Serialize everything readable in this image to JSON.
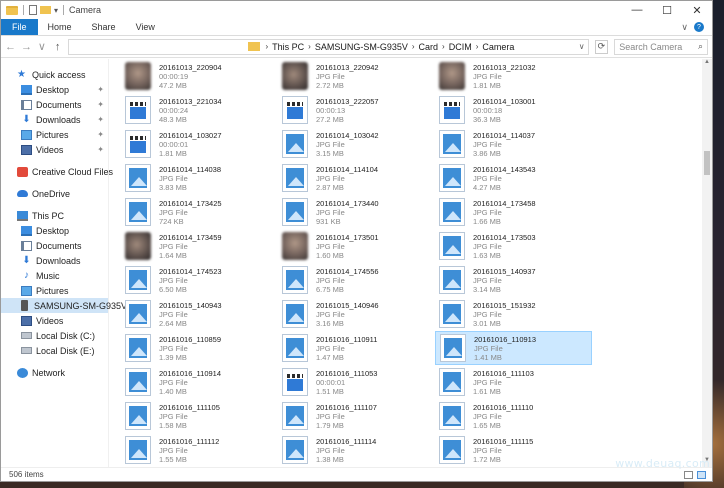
{
  "window": {
    "title": "Camera"
  },
  "title_controls": {
    "minimize": "—",
    "maximize": "☐",
    "close": "✕"
  },
  "ribbon": {
    "tabs": [
      "File",
      "Home",
      "Share",
      "View"
    ],
    "expand": "∨",
    "help": "?"
  },
  "nav_buttons": {
    "back": "←",
    "forward": "→",
    "recent": "∨",
    "up": "↑"
  },
  "address": {
    "crumbs": [
      "This PC",
      "SAMSUNG-SM-G935V",
      "Card",
      "DCIM",
      "Camera"
    ],
    "dropdown": "∨",
    "refresh": "⟳"
  },
  "search": {
    "placeholder": "Search Camera",
    "icon": "⌕"
  },
  "sidebar": {
    "items": [
      {
        "label": "Quick access",
        "icon": "star-icon"
      },
      {
        "label": "Desktop",
        "icon": "desktop-icon",
        "pinned": true
      },
      {
        "label": "Documents",
        "icon": "documents-icon",
        "pinned": true
      },
      {
        "label": "Downloads",
        "icon": "downloads-icon",
        "pinned": true
      },
      {
        "label": "Pictures",
        "icon": "pictures-icon",
        "pinned": true
      },
      {
        "label": "Videos",
        "icon": "videos-icon",
        "pinned": true
      },
      {
        "label": "Creative Cloud Files",
        "icon": "creative-cloud-icon"
      },
      {
        "label": "OneDrive",
        "icon": "onedrive-icon"
      },
      {
        "label": "This PC",
        "icon": "this-pc-icon"
      },
      {
        "label": "Desktop",
        "icon": "desktop-icon"
      },
      {
        "label": "Documents",
        "icon": "documents-icon"
      },
      {
        "label": "Downloads",
        "icon": "downloads-icon"
      },
      {
        "label": "Music",
        "icon": "music-icon"
      },
      {
        "label": "Pictures",
        "icon": "pictures-icon"
      },
      {
        "label": "SAMSUNG-SM-G935V",
        "icon": "phone-icon",
        "selected": true
      },
      {
        "label": "Videos",
        "icon": "videos-icon"
      },
      {
        "label": "Local Disk (C:)",
        "icon": "disk-icon"
      },
      {
        "label": "Local Disk (E:)",
        "icon": "disk-icon"
      },
      {
        "label": "Network",
        "icon": "network-icon"
      }
    ]
  },
  "files": [
    {
      "name": "20161013_220904",
      "type": "00:00:19",
      "size": "47.2 MB",
      "thumb": "blur"
    },
    {
      "name": "20161013_220942",
      "type": "JPG File",
      "size": "2.72 MB",
      "thumb": "blur"
    },
    {
      "name": "20161013_221032",
      "type": "JPG File",
      "size": "1.81 MB",
      "thumb": "blur"
    },
    {
      "name": "20161013_221034",
      "type": "00:00:24",
      "size": "48.3 MB",
      "thumb": "video"
    },
    {
      "name": "20161013_222057",
      "type": "00:00:13",
      "size": "27.2 MB",
      "thumb": "video"
    },
    {
      "name": "20161014_103001",
      "type": "00:00:18",
      "size": "36.3 MB",
      "thumb": "video"
    },
    {
      "name": "20161014_103027",
      "type": "00:00:01",
      "size": "1.81 MB",
      "thumb": "video"
    },
    {
      "name": "20161014_103042",
      "type": "JPG File",
      "size": "3.15 MB",
      "thumb": "photo"
    },
    {
      "name": "20161014_114037",
      "type": "JPG File",
      "size": "3.86 MB",
      "thumb": "photo"
    },
    {
      "name": "20161014_114038",
      "type": "JPG File",
      "size": "3.83 MB",
      "thumb": "photo"
    },
    {
      "name": "20161014_114104",
      "type": "JPG File",
      "size": "2.87 MB",
      "thumb": "photo"
    },
    {
      "name": "20161014_143543",
      "type": "JPG File",
      "size": "4.27 MB",
      "thumb": "photo"
    },
    {
      "name": "20161014_173425",
      "type": "JPG File",
      "size": "724 KB",
      "thumb": "photo"
    },
    {
      "name": "20161014_173440",
      "type": "JPG File",
      "size": "931 KB",
      "thumb": "photo"
    },
    {
      "name": "20161014_173458",
      "type": "JPG File",
      "size": "1.66 MB",
      "thumb": "photo"
    },
    {
      "name": "20161014_173459",
      "type": "JPG File",
      "size": "1.64 MB",
      "thumb": "blur"
    },
    {
      "name": "20161014_173501",
      "type": "JPG File",
      "size": "1.60 MB",
      "thumb": "blur"
    },
    {
      "name": "20161014_173503",
      "type": "JPG File",
      "size": "1.63 MB",
      "thumb": "photo"
    },
    {
      "name": "20161014_174523",
      "type": "JPG File",
      "size": "6.50 MB",
      "thumb": "photo"
    },
    {
      "name": "20161014_174556",
      "type": "JPG File",
      "size": "6.75 MB",
      "thumb": "photo"
    },
    {
      "name": "20161015_140937",
      "type": "JPG File",
      "size": "3.14 MB",
      "thumb": "photo"
    },
    {
      "name": "20161015_140943",
      "type": "JPG File",
      "size": "2.64 MB",
      "thumb": "photo"
    },
    {
      "name": "20161015_140946",
      "type": "JPG File",
      "size": "3.16 MB",
      "thumb": "photo"
    },
    {
      "name": "20161015_151932",
      "type": "JPG File",
      "size": "3.01 MB",
      "thumb": "photo"
    },
    {
      "name": "20161016_110859",
      "type": "JPG File",
      "size": "1.39 MB",
      "thumb": "photo"
    },
    {
      "name": "20161016_110911",
      "type": "JPG File",
      "size": "1.47 MB",
      "thumb": "photo"
    },
    {
      "name": "20161016_110913",
      "type": "JPG File",
      "size": "1.41 MB",
      "thumb": "photo",
      "selected": true
    },
    {
      "name": "20161016_110914",
      "type": "JPG File",
      "size": "1.40 MB",
      "thumb": "photo"
    },
    {
      "name": "20161016_111053",
      "type": "00:00:01",
      "size": "1.51 MB",
      "thumb": "video"
    },
    {
      "name": "20161016_111103",
      "type": "JPG File",
      "size": "1.61 MB",
      "thumb": "photo"
    },
    {
      "name": "20161016_111105",
      "type": "JPG File",
      "size": "1.58 MB",
      "thumb": "photo"
    },
    {
      "name": "20161016_111107",
      "type": "JPG File",
      "size": "1.79 MB",
      "thumb": "photo"
    },
    {
      "name": "20161016_111110",
      "type": "JPG File",
      "size": "1.65 MB",
      "thumb": "photo"
    },
    {
      "name": "20161016_111112",
      "type": "JPG File",
      "size": "1.55 MB",
      "thumb": "photo"
    },
    {
      "name": "20161016_111114",
      "type": "JPG File",
      "size": "1.38 MB",
      "thumb": "photo"
    },
    {
      "name": "20161016_111115",
      "type": "JPG File",
      "size": "1.72 MB",
      "thumb": "photo"
    }
  ],
  "status": {
    "count": "506 items"
  },
  "watermark": "www.deuaq.com",
  "colors": {
    "file_tab": "#1979ca",
    "address_highlight": "#32b43a",
    "selection": "#cce8ff"
  }
}
